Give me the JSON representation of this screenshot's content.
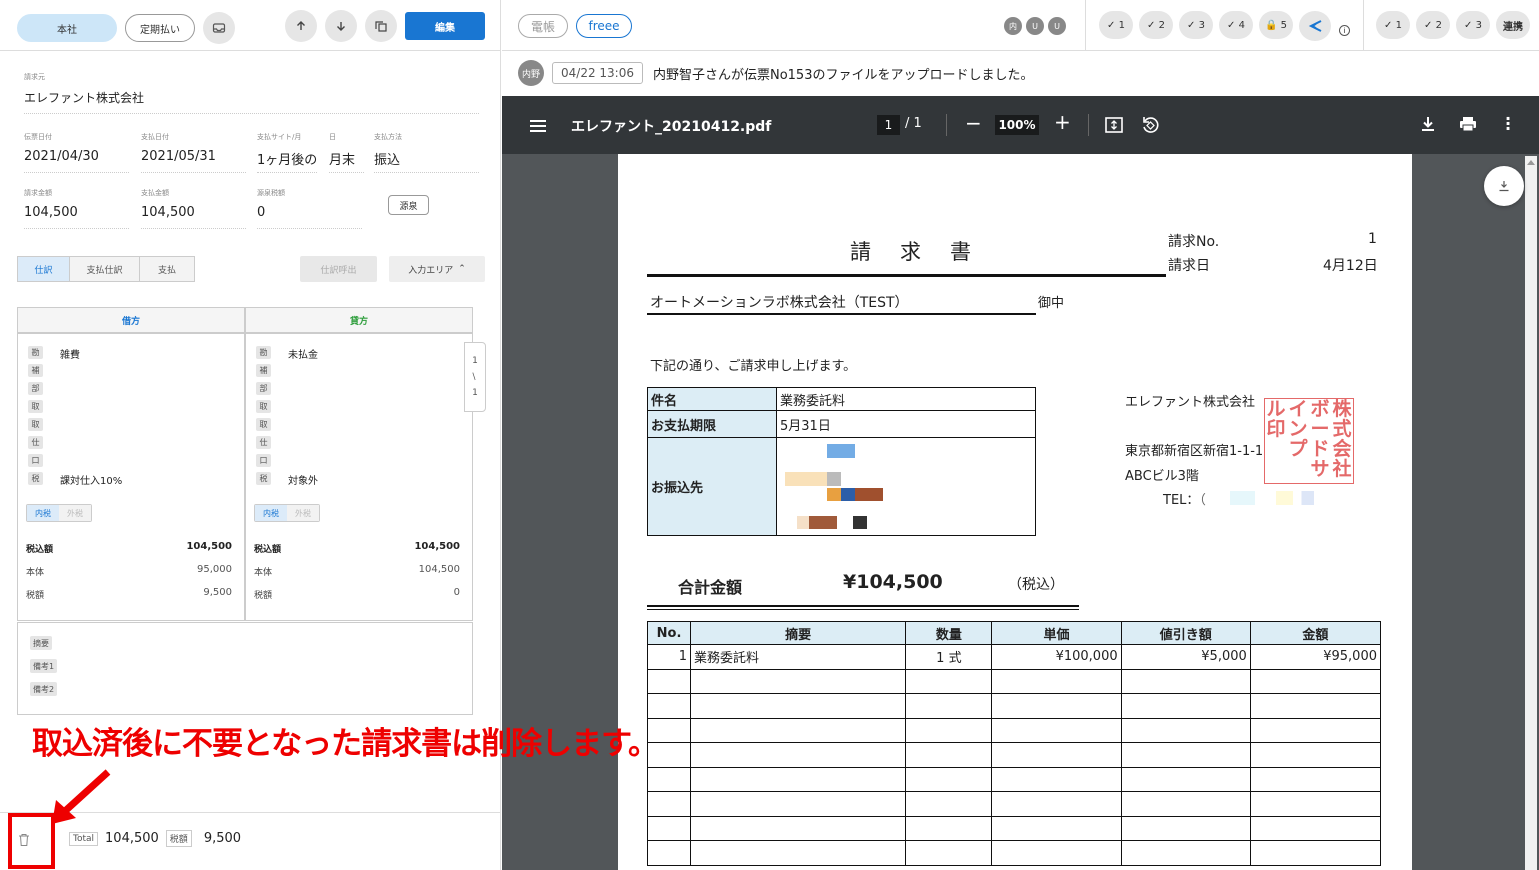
{
  "left": {
    "toolbar": {
      "honsha": "本社",
      "teiki": "定期払い",
      "edit": "編集"
    },
    "seikyumoto_label": "請求元",
    "seikyumoto": "エレファント株式会社",
    "fields1": [
      {
        "label": "伝票日付",
        "value": "2021/04/30"
      },
      {
        "label": "支払日付",
        "value": "2021/05/31"
      },
      {
        "label": "支払サイト/月",
        "value": "1ヶ月後の"
      },
      {
        "label": "日",
        "value": "月末"
      },
      {
        "label": "支払方法",
        "value": "振込"
      }
    ],
    "fields2": [
      {
        "label": "請求金額",
        "value": "104,500"
      },
      {
        "label": "支払金額",
        "value": "104,500"
      },
      {
        "label": "源泉税額",
        "value": "0"
      }
    ],
    "gensen_btn": "源泉",
    "tabs": [
      "仕訳",
      "支払仕訳",
      "支払"
    ],
    "shiwake_yobidashi": "仕訳呼出",
    "input_area": "入力エリア",
    "debit": {
      "title": "借方",
      "keys": [
        "勘",
        "補",
        "部",
        "取",
        "取",
        "仕",
        "口",
        "税"
      ],
      "kanjo": "雑費",
      "tax": "課対仕入10%",
      "toggle": [
        "内税",
        "外税"
      ],
      "rows": [
        {
          "label": "税込額",
          "value": "104,500"
        },
        {
          "label": "本体",
          "value": "95,000"
        },
        {
          "label": "税額",
          "value": "9,500"
        }
      ]
    },
    "credit": {
      "title": "貸方",
      "keys": [
        "勘",
        "補",
        "部",
        "取",
        "取",
        "仕",
        "口",
        "税"
      ],
      "kanjo": "未払金",
      "tax": "対象外",
      "toggle": [
        "内税",
        "外税"
      ],
      "rows": [
        {
          "label": "税込額",
          "value": "104,500"
        },
        {
          "label": "本体",
          "value": "104,500"
        },
        {
          "label": "税額",
          "value": "0"
        }
      ]
    },
    "pager": {
      "cur": "1",
      "sep": "/",
      "total": "1"
    },
    "memo": [
      "摘要",
      "備考1",
      "備考2"
    ],
    "footer": {
      "total_label": "Total",
      "total": "104,500",
      "tax_label": "税額",
      "tax": "9,500"
    }
  },
  "annotation": "取込済後に不要となった請求書は削除します。",
  "right": {
    "tags": [
      "電帳",
      "freee"
    ],
    "users": [
      "内",
      "U",
      "U"
    ],
    "checks1": [
      "✓ 1",
      "✓ 2",
      "✓ 3",
      "✓ 4",
      "🔒 5"
    ],
    "checks2": [
      "✓ 1",
      "✓ 2",
      "✓ 3"
    ],
    "renkei": "連携",
    "log": {
      "avatar": "内野",
      "time": "04/22 13:06",
      "text": "内野智子さんが伝票No153のファイルをアップロードしました。"
    },
    "pdf": {
      "filename": "エレファント_20210412.pdf",
      "page": "1",
      "pages": "1",
      "zoom": "100%"
    }
  },
  "invoice": {
    "title": "請　求　書",
    "no_label": "請求No.",
    "no": "1",
    "date_label": "請求日",
    "date": "4月12日",
    "to": "オートメーションラボ株式会社（TEST）",
    "onchu": "御中",
    "greeting": "下記の通り、ご請求申し上げます。",
    "kenmei_label": "件名",
    "kenmei": "業務委託料",
    "kigen_label": "お支払期限",
    "kigen": "5月31日",
    "furikomi_label": "お振込先",
    "company": "エレファント株式会社",
    "address": "東京都新宿区新宿1-1-1",
    "building": "ABCビル3階",
    "tel": "TEL：",
    "seal": [
      "株",
      "式",
      "会",
      "社",
      "ボ",
      "ー",
      "ド",
      "サ",
      "イ",
      "ン",
      "プ",
      "ル",
      "印"
    ],
    "total_label": "合計金額",
    "total": "¥104,500",
    "zeikomi": "（税込）",
    "headers": [
      "No.",
      "摘要",
      "数量",
      "単価",
      "値引き額",
      "金額"
    ],
    "rows": [
      [
        "1",
        "業務委託料",
        "1 式",
        "¥100,000",
        "¥5,000",
        "¥95,000"
      ]
    ]
  }
}
